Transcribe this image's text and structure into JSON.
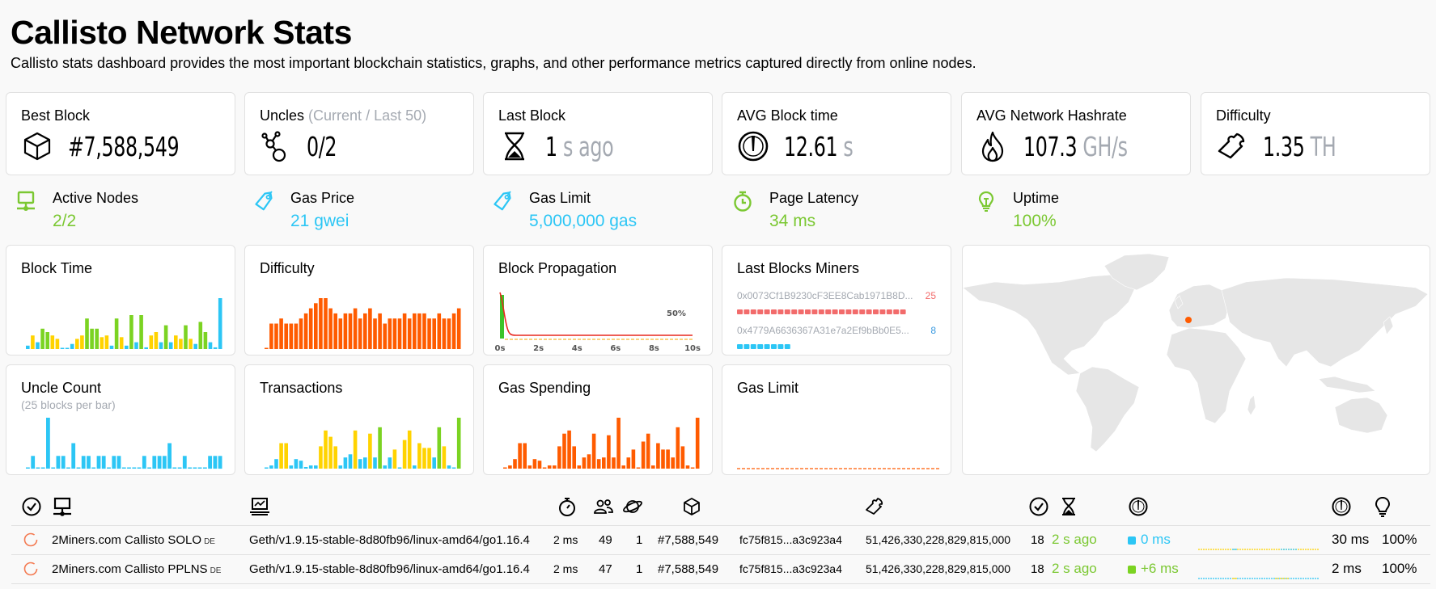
{
  "header": {
    "title": "Callisto Network Stats",
    "subtitle": "Callisto stats dashboard provides the most important blockchain statistics, graphs, and other performance metrics captured directly from online nodes."
  },
  "stats": [
    {
      "label": "Best Block",
      "label_muted": "",
      "icon": "cube-icon",
      "value": "#7,588,549",
      "unit": ""
    },
    {
      "label": "Uncles",
      "label_muted": "(Current / Last 50)",
      "icon": "uncles-icon",
      "value": "0/2",
      "unit": ""
    },
    {
      "label": "Last Block",
      "label_muted": "",
      "icon": "hourglass-icon",
      "value": "1",
      "unit": "s ago"
    },
    {
      "label": "AVG Block time",
      "label_muted": "",
      "icon": "gauge-icon",
      "value": "12.61",
      "unit": "s"
    },
    {
      "label": "AVG Network Hashrate",
      "label_muted": "",
      "icon": "flame-icon",
      "value": "107.3",
      "unit": "GH/s"
    },
    {
      "label": "Difficulty",
      "label_muted": "",
      "icon": "puzzle-icon",
      "value": "1.35",
      "unit": "TH"
    }
  ],
  "mini_stats": [
    {
      "label": "Active Nodes",
      "value": "2/2",
      "icon": "network-node-icon",
      "color": "#7bc832"
    },
    {
      "label": "Gas Price",
      "value": "21 gwei",
      "icon": "tag-icon",
      "color": "#2cc6f5"
    },
    {
      "label": "Gas Limit",
      "value": "5,000,000 gas",
      "icon": "tag-icon",
      "color": "#2cc6f5"
    },
    {
      "label": "Page Latency",
      "value": "34 ms",
      "icon": "stopwatch-icon",
      "color": "#7bc832"
    },
    {
      "label": "Uptime",
      "value": "100%",
      "icon": "lightbulb-icon",
      "color": "#7bc832"
    }
  ],
  "colors": {
    "blue": "#2cc6f5",
    "yellow": "#ffd300",
    "green": "#7bd322",
    "orange": "#ff5b00",
    "red": "#f26b6b",
    "muted": "#a4a9b1"
  },
  "chart_data": [
    {
      "type": "bar",
      "title": "Block Time",
      "values": [
        1,
        4,
        2,
        6,
        5,
        4,
        3,
        0.2,
        0.2,
        1.5,
        3,
        4,
        9,
        6,
        6,
        3.5,
        4,
        1,
        9,
        3.5,
        1,
        10,
        2,
        10,
        0.5,
        4,
        5,
        2,
        7,
        2,
        4,
        3,
        7,
        3,
        1.5,
        8,
        5,
        2,
        0.5,
        15
      ],
      "colors": [
        "b",
        "y",
        "b",
        "g",
        "g",
        "y",
        "y",
        "b",
        "b",
        "b",
        "y",
        "y",
        "g",
        "g",
        "g",
        "y",
        "y",
        "b",
        "g",
        "y",
        "b",
        "g",
        "b",
        "g",
        "b",
        "y",
        "y",
        "b",
        "g",
        "b",
        "y",
        "y",
        "g",
        "y",
        "b",
        "g",
        "g",
        "b",
        "b",
        "b"
      ]
    },
    {
      "type": "bar",
      "title": "Difficulty",
      "values": [
        0.2,
        5,
        5,
        6,
        5,
        5,
        5,
        6,
        7,
        8,
        9,
        10,
        10,
        8,
        7,
        6,
        7,
        7,
        8,
        6,
        7,
        8,
        6,
        7,
        5,
        6,
        6,
        6,
        7,
        6,
        7,
        7,
        7,
        6,
        6,
        7,
        6,
        6,
        7,
        8
      ],
      "color": "orange"
    },
    {
      "type": "line",
      "title": "Block Propagation",
      "x_ticks": [
        "0s",
        "2s",
        "4s",
        "6s",
        "8s",
        "10s"
      ],
      "annotation": "50%",
      "xlim": [
        0,
        10
      ]
    },
    {
      "type": "bar",
      "title": "Last Blocks Miners",
      "miners": [
        {
          "address": "0x0073Cf1B9230cF3EE8Cab1971B8D...",
          "count": 25,
          "color": "#f26b6b"
        },
        {
          "address": "0x4779A6636367A31e7a2Ef9bBb0E5...",
          "count": 8,
          "color": "#2cc6f5"
        }
      ]
    },
    {
      "type": "bar",
      "title": "Uncle Count",
      "subtitle": "(25 blocks per bar)",
      "values": [
        0,
        1,
        0,
        0,
        4,
        0,
        1,
        1,
        0,
        2,
        0,
        1,
        1,
        0,
        1,
        1,
        0,
        1,
        1,
        0,
        0,
        0,
        0,
        1,
        0,
        1,
        1,
        1,
        2,
        0,
        0,
        1,
        0,
        0,
        0,
        0,
        1,
        1,
        1
      ],
      "color": "blue"
    },
    {
      "type": "bar",
      "title": "Transactions",
      "values": [
        0.2,
        1,
        3,
        8,
        8,
        1,
        3,
        2.5,
        0.5,
        1,
        1,
        7,
        12,
        10,
        7,
        1,
        3.5,
        4.5,
        12,
        3,
        3.5,
        11,
        3.5,
        13,
        1,
        3.5,
        6,
        0.3,
        9,
        12,
        1,
        8,
        6.5,
        6.5,
        3.5,
        13,
        7,
        1,
        0.3,
        16
      ],
      "colors": [
        "b",
        "b",
        "b",
        "y",
        "y",
        "b",
        "b",
        "b",
        "b",
        "b",
        "b",
        "y",
        "y",
        "y",
        "y",
        "b",
        "b",
        "b",
        "y",
        "b",
        "b",
        "y",
        "b",
        "g",
        "b",
        "b",
        "y",
        "b",
        "y",
        "y",
        "b",
        "y",
        "y",
        "y",
        "b",
        "g",
        "y",
        "b",
        "b",
        "g"
      ]
    },
    {
      "type": "bar",
      "title": "Gas Spending",
      "values": [
        0.2,
        1,
        3,
        8,
        8,
        1,
        3,
        2.5,
        0.2,
        1,
        1,
        7,
        11,
        12,
        7,
        1,
        3.5,
        4.5,
        11,
        3,
        3.5,
        10.5,
        3.5,
        16,
        1,
        3.5,
        6,
        0.2,
        8.5,
        11,
        1,
        8,
        6,
        6,
        3.5,
        13,
        7,
        1,
        0.2,
        16
      ],
      "color": "orange"
    },
    {
      "type": "line",
      "title": "Gas Limit",
      "values": [
        5000000
      ],
      "color": "orange"
    }
  ],
  "map": {
    "markers": [
      {
        "label": "DE",
        "color": "#ff5b00"
      }
    ]
  },
  "table": {
    "header_icons": [
      "check-circle-icon",
      "node-icon",
      "laptop-chart-icon",
      "stopwatch-icon",
      "peers-icon",
      "planet-icon",
      "cube-icon",
      "puzzle-icon",
      "check-circle-icon",
      "hourglass-icon",
      "gauge-icon",
      "gauge-icon",
      "lightbulb-icon"
    ],
    "rows": [
      {
        "name": "2Miners.com Callisto SOLO",
        "country": "DE",
        "client": "Geth/v1.9.15-stable-8d80fb96/linux-amd64/go1.16.4",
        "latency": "2 ms",
        "peers": "49",
        "pending": "1",
        "block": "#7,588,549",
        "hash": "fc75f815...a3c923a4",
        "total_difficulty": "51,426,330,228,829,815,000",
        "txs": "18",
        "last_block": "2 s ago",
        "propagation": "0 ms",
        "propagation_color": "#2cc6f5",
        "avg_propagation": "30 ms",
        "uptime": "100%"
      },
      {
        "name": "2Miners.com Callisto PPLNS",
        "country": "DE",
        "client": "Geth/v1.9.15-stable-8d80fb96/linux-amd64/go1.16.4",
        "latency": "2 ms",
        "peers": "47",
        "pending": "1",
        "block": "#7,588,549",
        "hash": "fc75f815...a3c923a4",
        "total_difficulty": "51,426,330,228,829,815,000",
        "txs": "18",
        "last_block": "2 s ago",
        "propagation": "+6 ms",
        "propagation_color": "#7bd322",
        "avg_propagation": "2 ms",
        "uptime": "100%"
      }
    ]
  }
}
